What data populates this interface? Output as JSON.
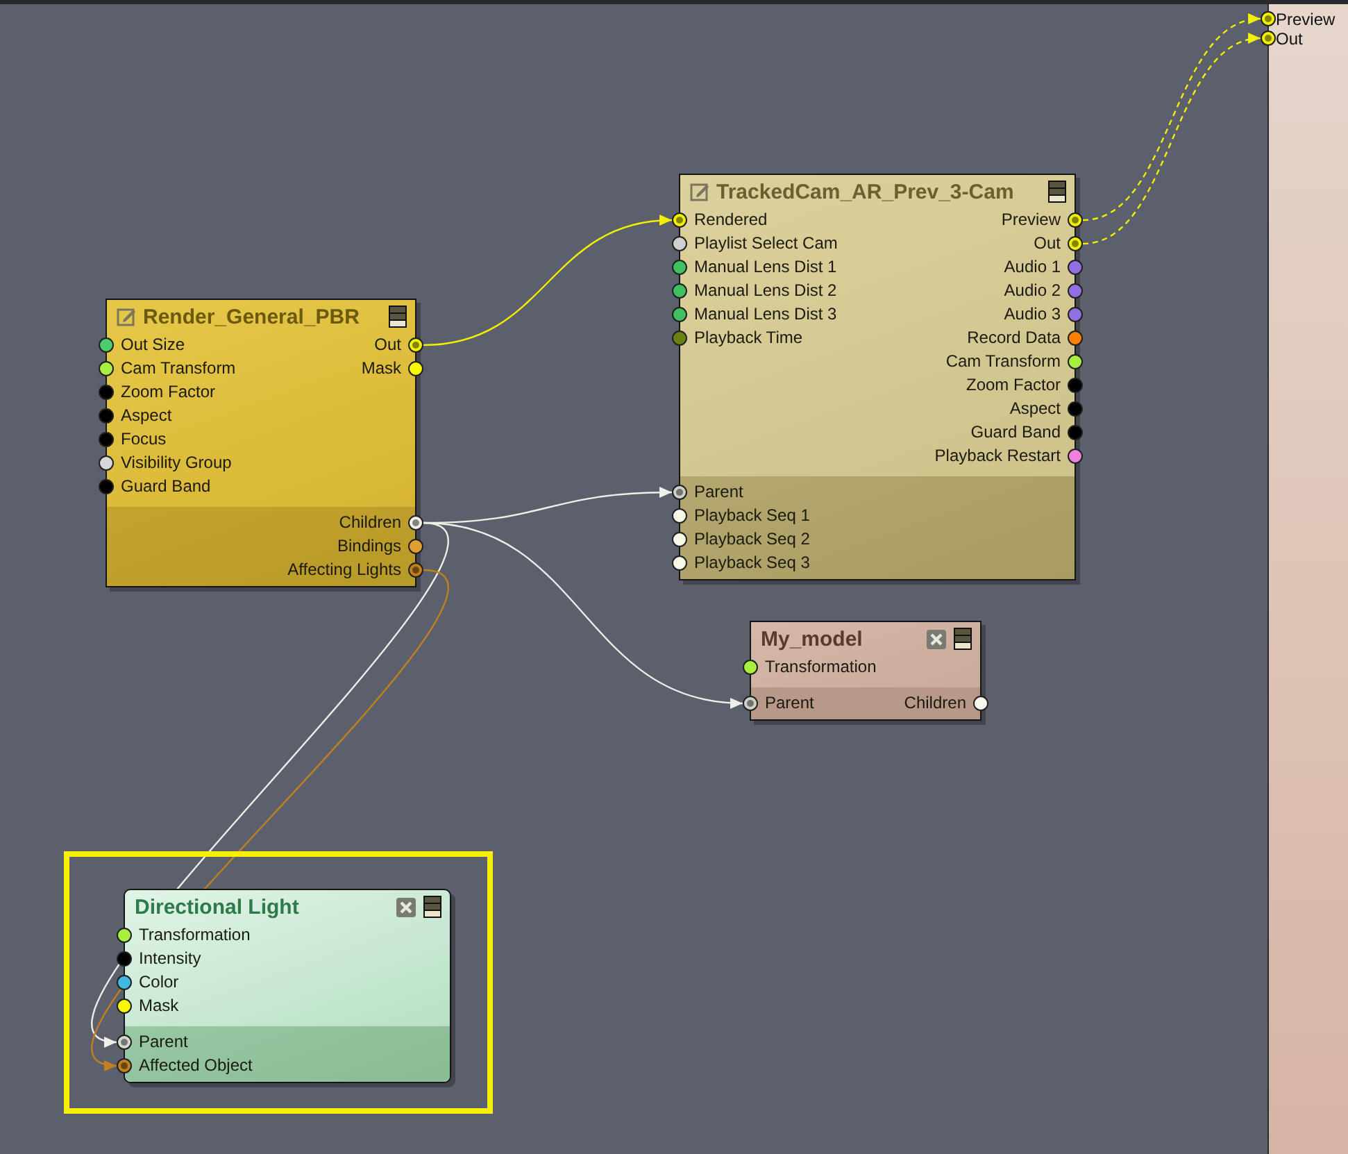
{
  "nodes": [
    {
      "title": "Render_General_PBR",
      "kind": "render",
      "selected": false,
      "inputs": [
        {
          "label": "Out Size",
          "color": "#4ccc6c",
          "connected": false
        },
        {
          "label": "Cam Transform",
          "color": "#a8f040",
          "connected": false
        },
        {
          "label": "Zoom Factor",
          "color": "#000000",
          "connected": false
        },
        {
          "label": "Aspect",
          "color": "#000000",
          "connected": false
        },
        {
          "label": "Focus",
          "color": "#000000",
          "connected": false
        },
        {
          "label": "Visibility Group",
          "color": "#d8d8d8",
          "connected": false
        },
        {
          "label": "Guard Band",
          "color": "#000000",
          "connected": false
        }
      ],
      "outputs": [
        {
          "label": "Out",
          "color": "#f0f000",
          "connected": true
        },
        {
          "label": "Mask",
          "color": "#f8f800",
          "connected": false
        }
      ],
      "lower_outputs": [
        {
          "label": "Children",
          "color": "#f0f0e8",
          "connected": true
        },
        {
          "label": "Bindings",
          "color": "#e0a030",
          "connected": false
        },
        {
          "label": "Affecting Lights",
          "color": "#c08020",
          "connected": true
        }
      ]
    },
    {
      "title": "TrackedCam_AR_Prev_3-Cam",
      "kind": "camera",
      "selected": false,
      "inputs": [
        {
          "label": "Rendered",
          "color": "#f0f000",
          "connected": true
        },
        {
          "label": "Playlist Select Cam",
          "color": "#d0d0d0",
          "connected": false
        },
        {
          "label": "Manual Lens Dist 1",
          "color": "#40c060",
          "connected": false
        },
        {
          "label": "Manual Lens Dist 2",
          "color": "#40c060",
          "connected": false
        },
        {
          "label": "Manual Lens Dist 3",
          "color": "#40c060",
          "connected": false
        },
        {
          "label": "Playback Time",
          "color": "#6a8010",
          "connected": false
        }
      ],
      "outputs": [
        {
          "label": "Preview",
          "color": "#f0f000",
          "connected": true
        },
        {
          "label": "Out",
          "color": "#f0f000",
          "connected": true
        },
        {
          "label": "Audio 1",
          "color": "#9070e0",
          "connected": false
        },
        {
          "label": "Audio 2",
          "color": "#9070e0",
          "connected": false
        },
        {
          "label": "Audio 3",
          "color": "#9070e0",
          "connected": false
        },
        {
          "label": "Record Data",
          "color": "#ff8000",
          "connected": false
        },
        {
          "label": "Cam Transform",
          "color": "#a8f040",
          "connected": false
        },
        {
          "label": "Zoom Factor",
          "color": "#000000",
          "connected": false
        },
        {
          "label": "Aspect",
          "color": "#000000",
          "connected": false
        },
        {
          "label": "Guard Band",
          "color": "#000000",
          "connected": false
        },
        {
          "label": "Playback Restart",
          "color": "#f080e0",
          "connected": false
        }
      ],
      "lower_inputs": [
        {
          "label": "Parent",
          "color": "#d0d0c8",
          "connected": true
        },
        {
          "label": "Playback Seq 1",
          "color": "#f8f8e8",
          "connected": false
        },
        {
          "label": "Playback Seq 2",
          "color": "#f8f8e8",
          "connected": false
        },
        {
          "label": "Playback Seq 3",
          "color": "#f8f8e8",
          "connected": false
        }
      ]
    },
    {
      "title": "My_model",
      "kind": "model",
      "selected": false,
      "inputs": [
        {
          "label": "Transformation",
          "color": "#a8f040",
          "connected": false
        }
      ],
      "lower_inputs": [
        {
          "label": "Parent",
          "color": "#d0d0c8",
          "connected": true
        }
      ],
      "lower_outputs": [
        {
          "label": "Children",
          "color": "#f8f8f0",
          "connected": false
        }
      ]
    },
    {
      "title": "Directional Light",
      "kind": "light",
      "selected": true,
      "inputs": [
        {
          "label": "Transformation",
          "color": "#a8f040",
          "connected": false
        },
        {
          "label": "Intensity",
          "color": "#000000",
          "connected": false
        },
        {
          "label": "Color",
          "color": "#40b8e0",
          "connected": false
        },
        {
          "label": "Mask",
          "color": "#f8f800",
          "connected": false
        }
      ],
      "lower_inputs": [
        {
          "label": "Parent",
          "color": "#d8d8d0",
          "connected": true
        },
        {
          "label": "Affected Object",
          "color": "#c08020",
          "connected": true
        }
      ]
    }
  ],
  "output_panel": {
    "ports": [
      {
        "label": "Preview",
        "color": "#f0f000",
        "connected": true
      },
      {
        "label": "Out",
        "color": "#f0f000",
        "connected": true
      }
    ]
  }
}
